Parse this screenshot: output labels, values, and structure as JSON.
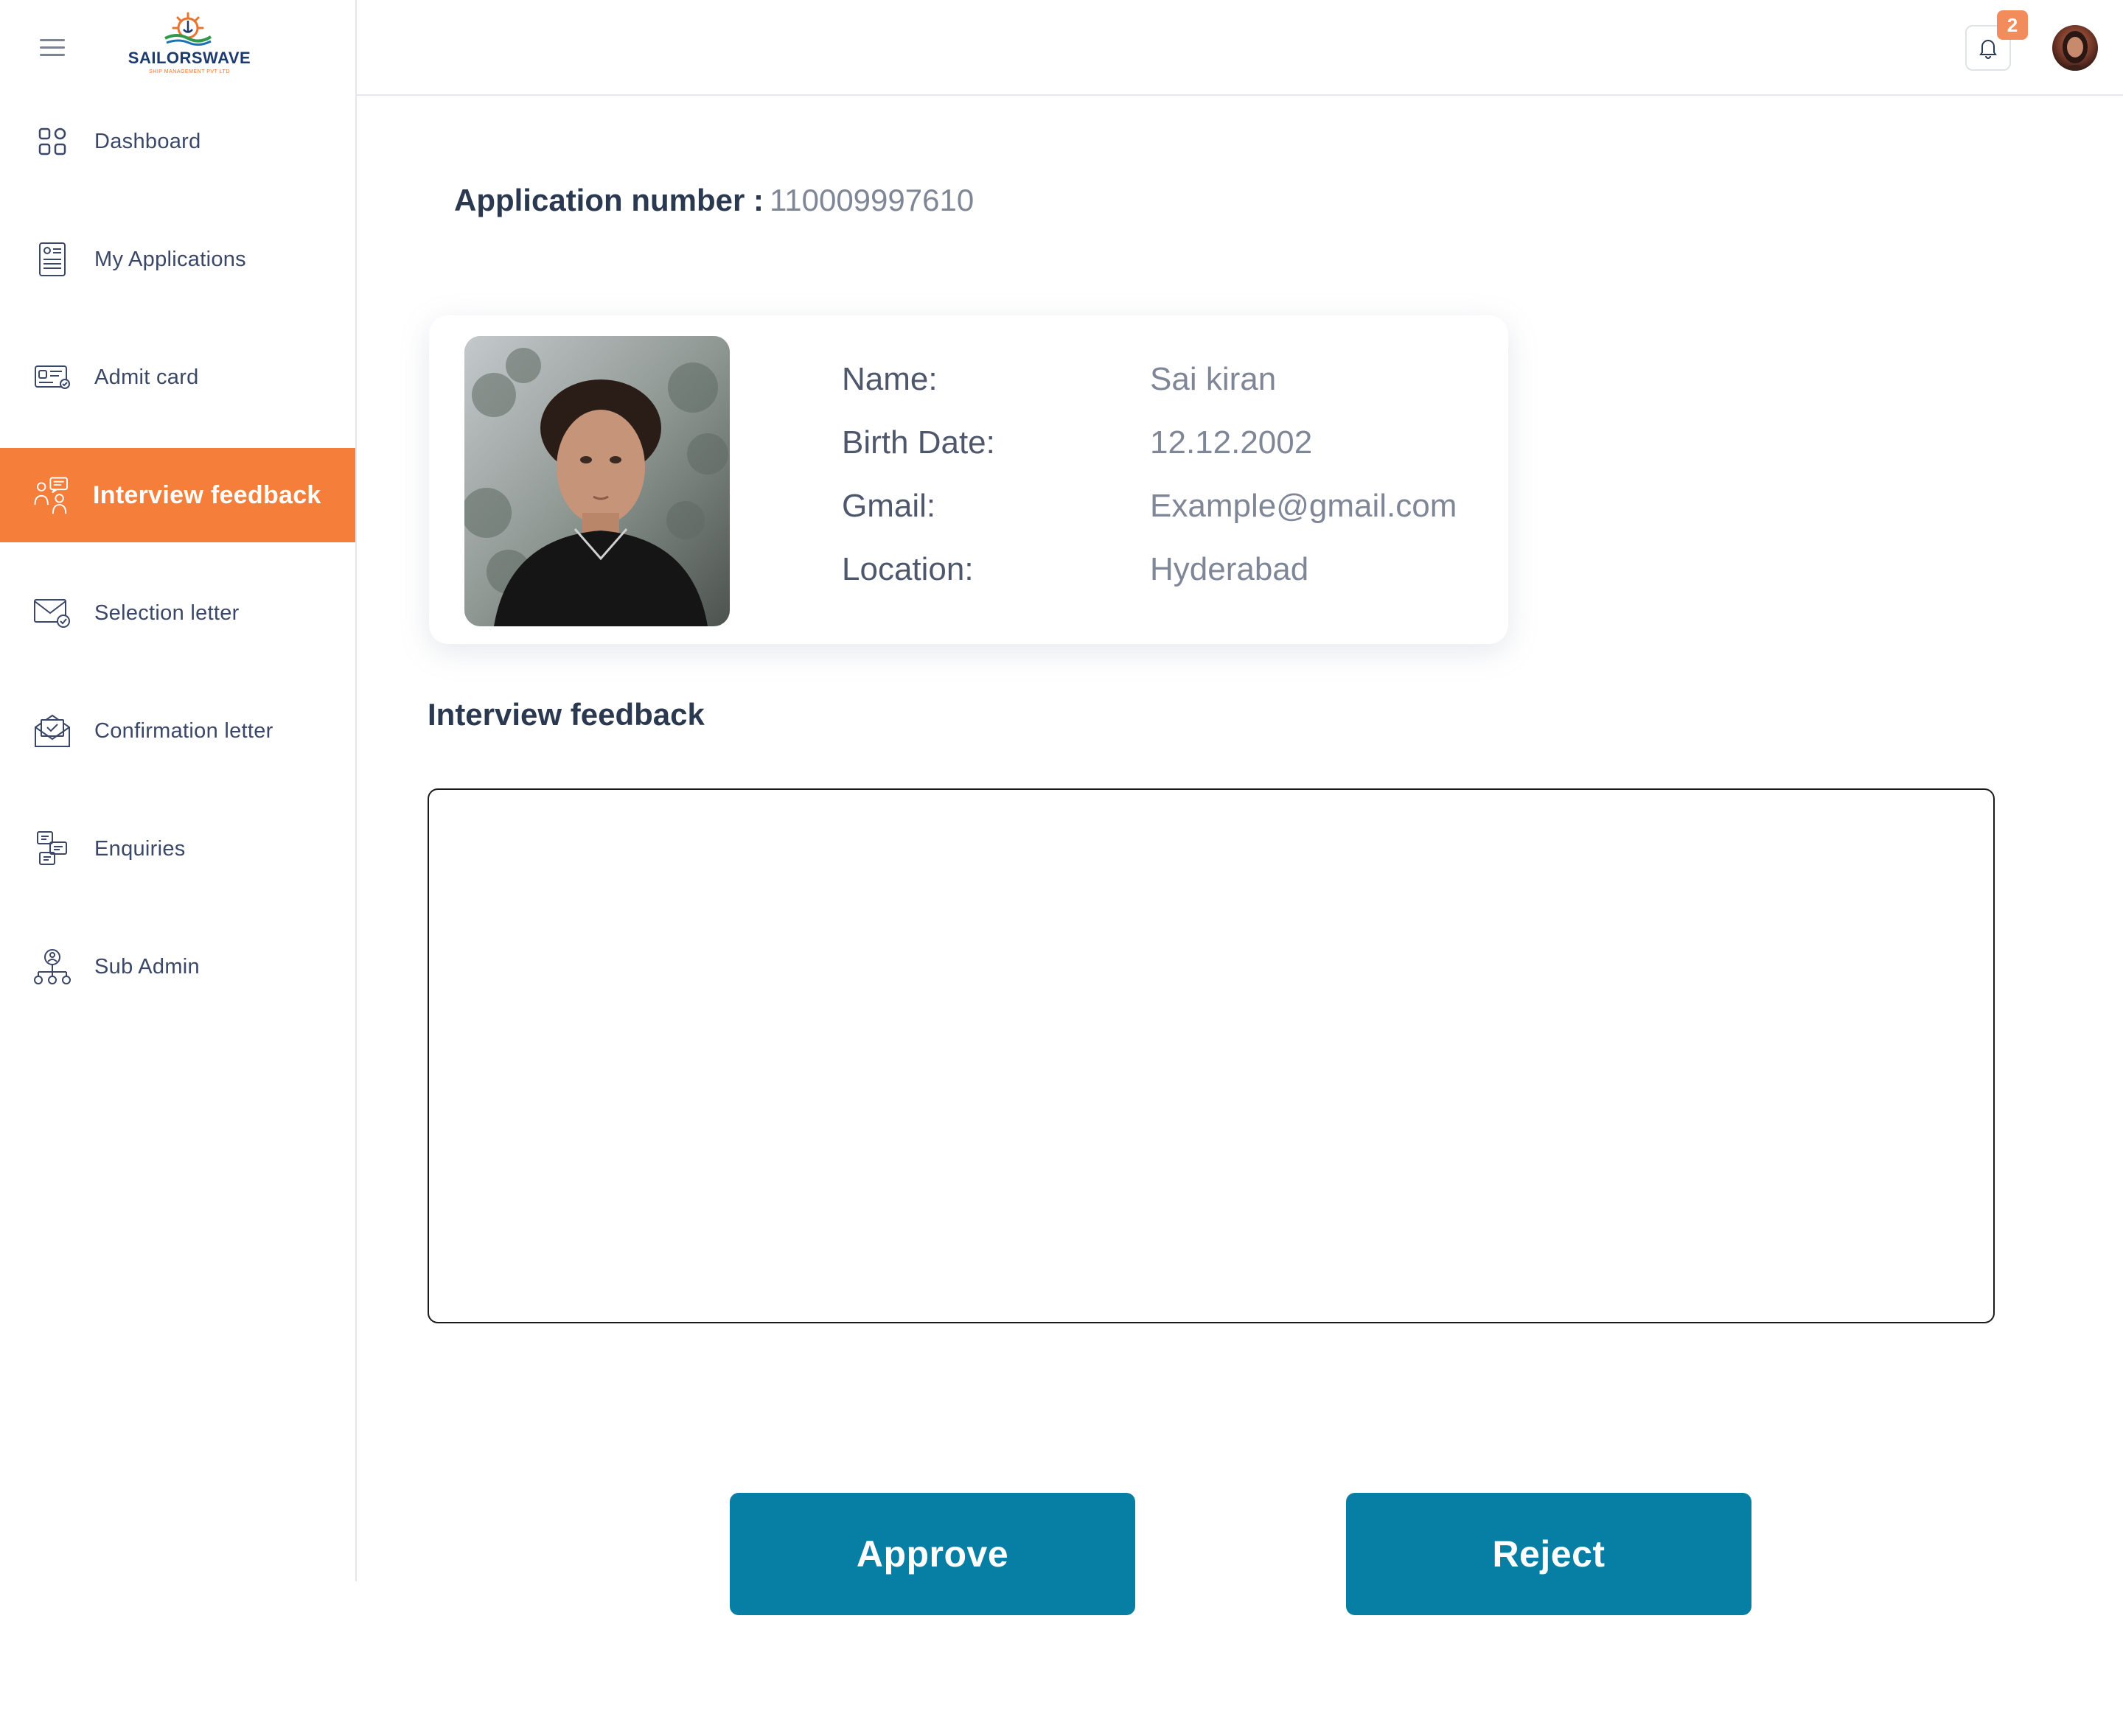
{
  "brand": {
    "name": "SAILORSWAVE",
    "tagline": "SHIP MANAGEMENT PVT LTD"
  },
  "sidebar": {
    "items": [
      {
        "label": "Dashboard",
        "icon": "dashboard-grid-icon",
        "active": false
      },
      {
        "label": "My Applications",
        "icon": "document-list-icon",
        "active": false
      },
      {
        "label": "Admit card",
        "icon": "id-card-icon",
        "active": false
      },
      {
        "label": "Interview feedback",
        "icon": "interview-feedback-icon",
        "active": true
      },
      {
        "label": "Selection letter",
        "icon": "envelope-check-icon",
        "active": false
      },
      {
        "label": "Confirmation letter",
        "icon": "open-envelope-icon",
        "active": false
      },
      {
        "label": "Enquiries",
        "icon": "enquiries-icon",
        "active": false
      },
      {
        "label": "Sub Admin",
        "icon": "org-chart-icon",
        "active": false
      }
    ]
  },
  "header": {
    "notification_count": "2"
  },
  "application": {
    "label": "Application number :",
    "number": "110009997610"
  },
  "profile": {
    "name_label": "Name:",
    "name": "Sai kiran",
    "birth_label": "Birth Date:",
    "birth_date": "12.12.2002",
    "gmail_label": "Gmail:",
    "gmail": "Example@gmail.com",
    "location_label": "Location:",
    "location": "Hyderabad"
  },
  "feedback": {
    "title": "Interview feedback",
    "value": "",
    "placeholder": ""
  },
  "actions": {
    "approve": "Approve",
    "reject": "Reject"
  },
  "colors": {
    "accent_orange": "#f47e3a",
    "primary_button": "#077ea3",
    "badge": "#f28c5a",
    "heading": "#2b3950"
  }
}
